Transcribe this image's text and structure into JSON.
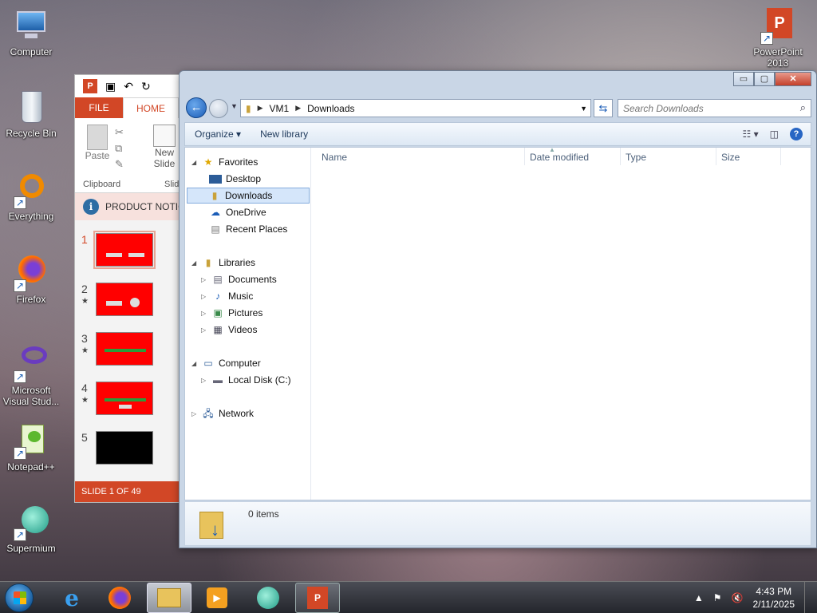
{
  "desktop": {
    "icons": [
      {
        "label": "Computer"
      },
      {
        "label": "Recycle Bin"
      },
      {
        "label": "Everything"
      },
      {
        "label": "Firefox"
      },
      {
        "label": "Microsoft Visual Stud..."
      },
      {
        "label": "Notepad++"
      },
      {
        "label": "Supermium"
      },
      {
        "label": "PowerPoint 2013"
      }
    ]
  },
  "powerpoint": {
    "tabs": {
      "file": "FILE",
      "home": "HOME"
    },
    "ribbon": {
      "paste": "Paste",
      "new_slide": "New Slide",
      "clipboard_group": "Clipboard",
      "slides_group": "Slid"
    },
    "notice": "PRODUCT NOTIC",
    "slides": [
      {
        "num": "1",
        "star": ""
      },
      {
        "num": "2",
        "star": "★"
      },
      {
        "num": "3",
        "star": "★"
      },
      {
        "num": "4",
        "star": "★"
      },
      {
        "num": "5",
        "star": ""
      }
    ],
    "status": "SLIDE 1 OF 49"
  },
  "explorer": {
    "caption": {
      "minimize": "▭",
      "maximize": "▢",
      "close": "✕"
    },
    "address": {
      "root": "VM1",
      "current": "Downloads"
    },
    "search_placeholder": "Search Downloads",
    "commands": {
      "organize": "Organize ▾",
      "new_library": "New library"
    },
    "nav": {
      "favorites": "Favorites",
      "desktop": "Desktop",
      "downloads": "Downloads",
      "onedrive": "OneDrive",
      "recent": "Recent Places",
      "libraries": "Libraries",
      "documents": "Documents",
      "music": "Music",
      "pictures": "Pictures",
      "videos": "Videos",
      "computer": "Computer",
      "local_disk": "Local Disk (C:)",
      "network": "Network"
    },
    "columns": {
      "name": "Name",
      "date": "Date modified",
      "type": "Type",
      "size": "Size"
    },
    "details": {
      "count": "0 items"
    }
  },
  "taskbar": {
    "time": "4:43 PM",
    "date": "2/11/2025"
  },
  "colors": {
    "accent_ppt": "#d24726",
    "selection": "#d5e6fa"
  }
}
